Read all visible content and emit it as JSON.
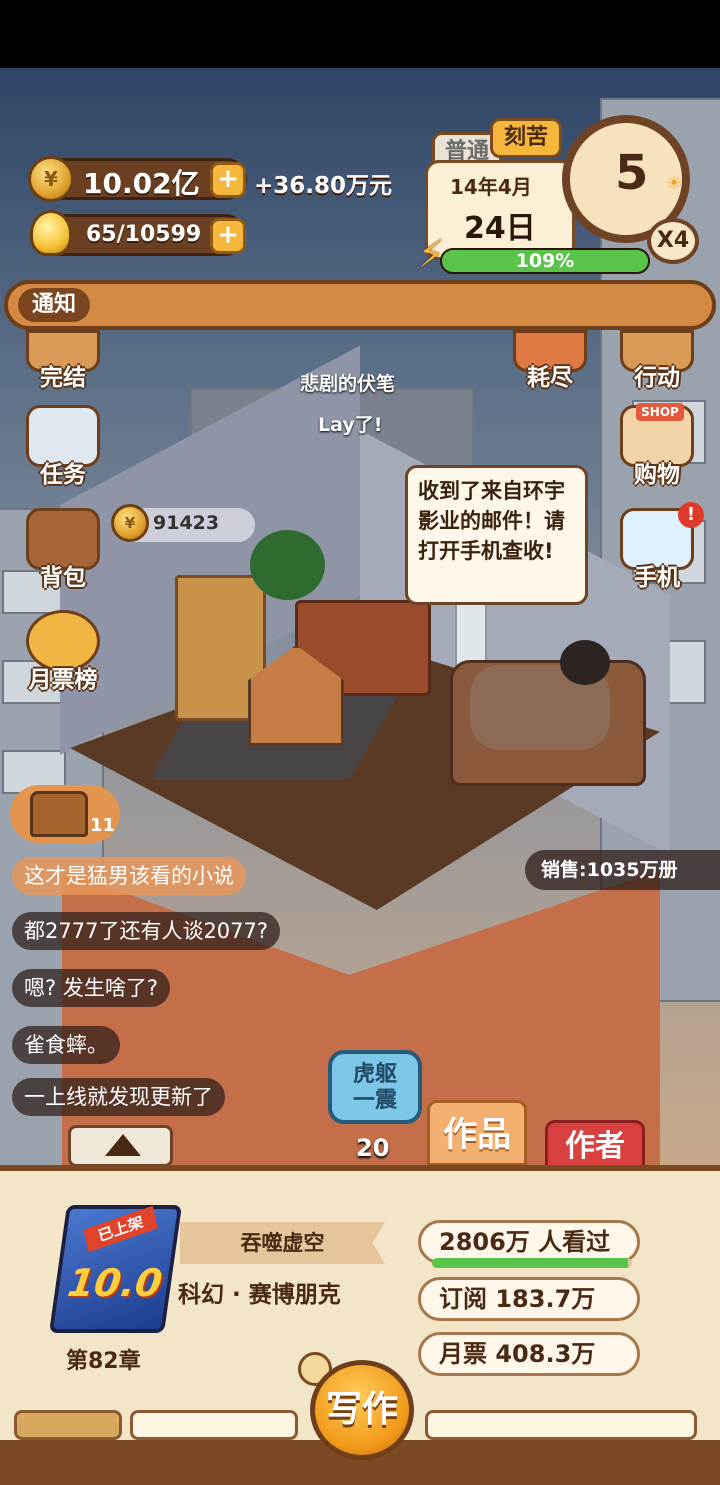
{
  "hud": {
    "money": "10.02亿",
    "income": "+36.80万元",
    "inspiration": "65/10599",
    "plus_symbol": "+",
    "mode_normal": "普通",
    "mode_hard": "刻苦",
    "date_year_month": "14年4月",
    "date_day": "24日",
    "energy_percent": "109%",
    "energy_value": 1.0,
    "clock_number": "5",
    "speed_label": "X4"
  },
  "notice": {
    "label": "通知"
  },
  "side_left": [
    {
      "label": "完结",
      "icon": "book-icon"
    },
    {
      "label": "任务",
      "icon": "checklist-icon"
    },
    {
      "label": "背包",
      "icon": "bag-icon"
    },
    {
      "label": "月票榜",
      "icon": "ticket-icon"
    }
  ],
  "side_right": [
    {
      "label": "耗尽",
      "icon": "target-icon"
    },
    {
      "label": "行动",
      "icon": "action-icon"
    },
    {
      "label": "购物",
      "icon": "shop-icon",
      "badge": "SHOP"
    },
    {
      "label": "手机",
      "icon": "phone-icon",
      "alert": "!"
    }
  ],
  "scene": {
    "float_line1": "悲剧的伏笔",
    "float_line2": "Lay了!",
    "speech": "收到了来自环宇影业的邮件！请打开手机查收!",
    "coin_bubble": "91423",
    "chest_count": "11"
  },
  "chat": [
    "这才是猛男该看的小说",
    "都2777了还有人谈2077?",
    "嗯? 发生啥了?",
    "雀食蟀。",
    "一上线就发现更新了"
  ],
  "sales": "销售:1035万册",
  "skill": {
    "line1": "虎躯",
    "line2": "一震",
    "count": "20"
  },
  "tabs": {
    "works": "作品",
    "author": "作者"
  },
  "book": {
    "tag": "已上架",
    "score": "10.0",
    "title": "吞噬虚空",
    "genre": "科幻 · 赛博朋克",
    "chapter": "第82章",
    "views": "2806万 人看过",
    "views_progress": 0.98,
    "subscriptions": "订阅 183.7万",
    "monthly_tickets": "月票 408.3万"
  },
  "write_button": "写作"
}
